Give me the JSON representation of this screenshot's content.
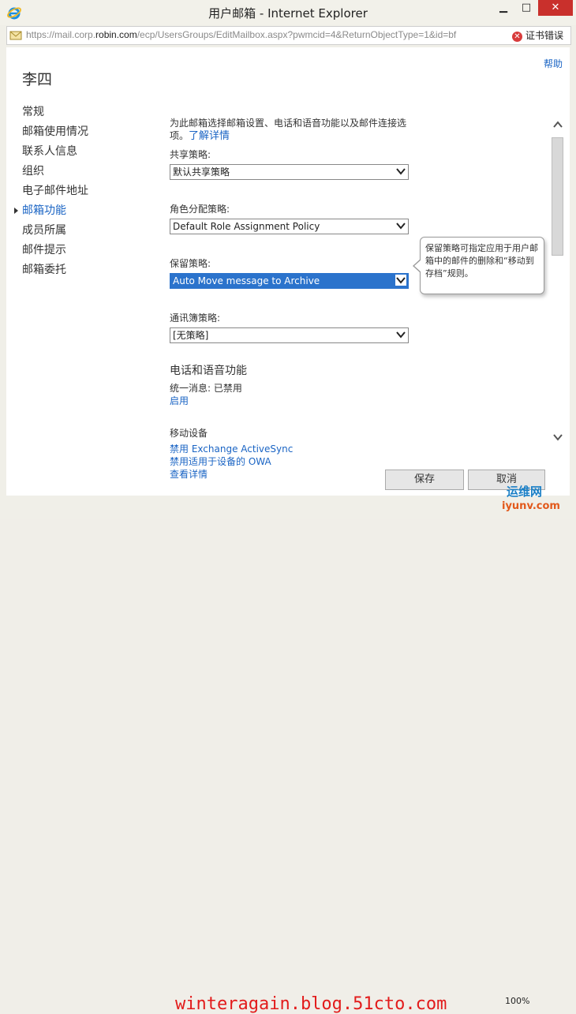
{
  "window": {
    "title": "用户邮箱 - Internet Explorer",
    "minimize": "▁",
    "maximize": "□",
    "close": "✕"
  },
  "address": {
    "url_prefix": "https://mail.corp.",
    "url_domain": "robin.com",
    "url_rest": "/ecp/UsersGroups/EditMailbox.aspx?pwmcid=4&ReturnObjectType=1&id=bf",
    "cert_error": "证书错误"
  },
  "page": {
    "help": "帮助",
    "title": "李四"
  },
  "nav": {
    "items": [
      {
        "label": "常规"
      },
      {
        "label": "邮箱使用情况"
      },
      {
        "label": "联系人信息"
      },
      {
        "label": "组织"
      },
      {
        "label": "电子邮件地址"
      },
      {
        "label": "邮箱功能"
      },
      {
        "label": "成员所属"
      },
      {
        "label": "邮件提示"
      },
      {
        "label": "邮箱委托"
      }
    ],
    "active_index": 5
  },
  "form": {
    "intro": "为此邮箱选择邮箱设置、电话和语音功能以及邮件连接选项。",
    "intro_link": "了解详情",
    "sharing_label": "共享策略:",
    "sharing_value": "默认共享策略",
    "role_label": "角色分配策略:",
    "role_value": "Default Role Assignment Policy",
    "retention_label": "保留策略:",
    "retention_value": "Auto Move message to Archive",
    "addressbook_label": "通讯簿策略:",
    "addressbook_value": "[无策略]"
  },
  "phone": {
    "title": "电话和语音功能",
    "um_status": "统一消息: 已禁用",
    "enable_link": "启用"
  },
  "mobile": {
    "title": "移动设备",
    "disable_activesync": "禁用 Exchange ActiveSync",
    "disable_owa": "禁用适用于设备的 OWA",
    "view_details": "查看详情"
  },
  "tooltip": {
    "text": "保留策略可指定应用于用户邮箱中的邮件的删除和“移动到存档”规则。"
  },
  "buttons": {
    "save": "保存",
    "cancel": "取消"
  },
  "status": {
    "watermark": "winteragain.blog.51cto.com",
    "zoom": "100%",
    "logo_text": "运维网",
    "logo_url": "iyunv.com"
  },
  "colors": {
    "link": "#1a64c4",
    "selected": "#2b73cc",
    "close_button": "#c9302c",
    "watermark": "#e21b1b"
  }
}
